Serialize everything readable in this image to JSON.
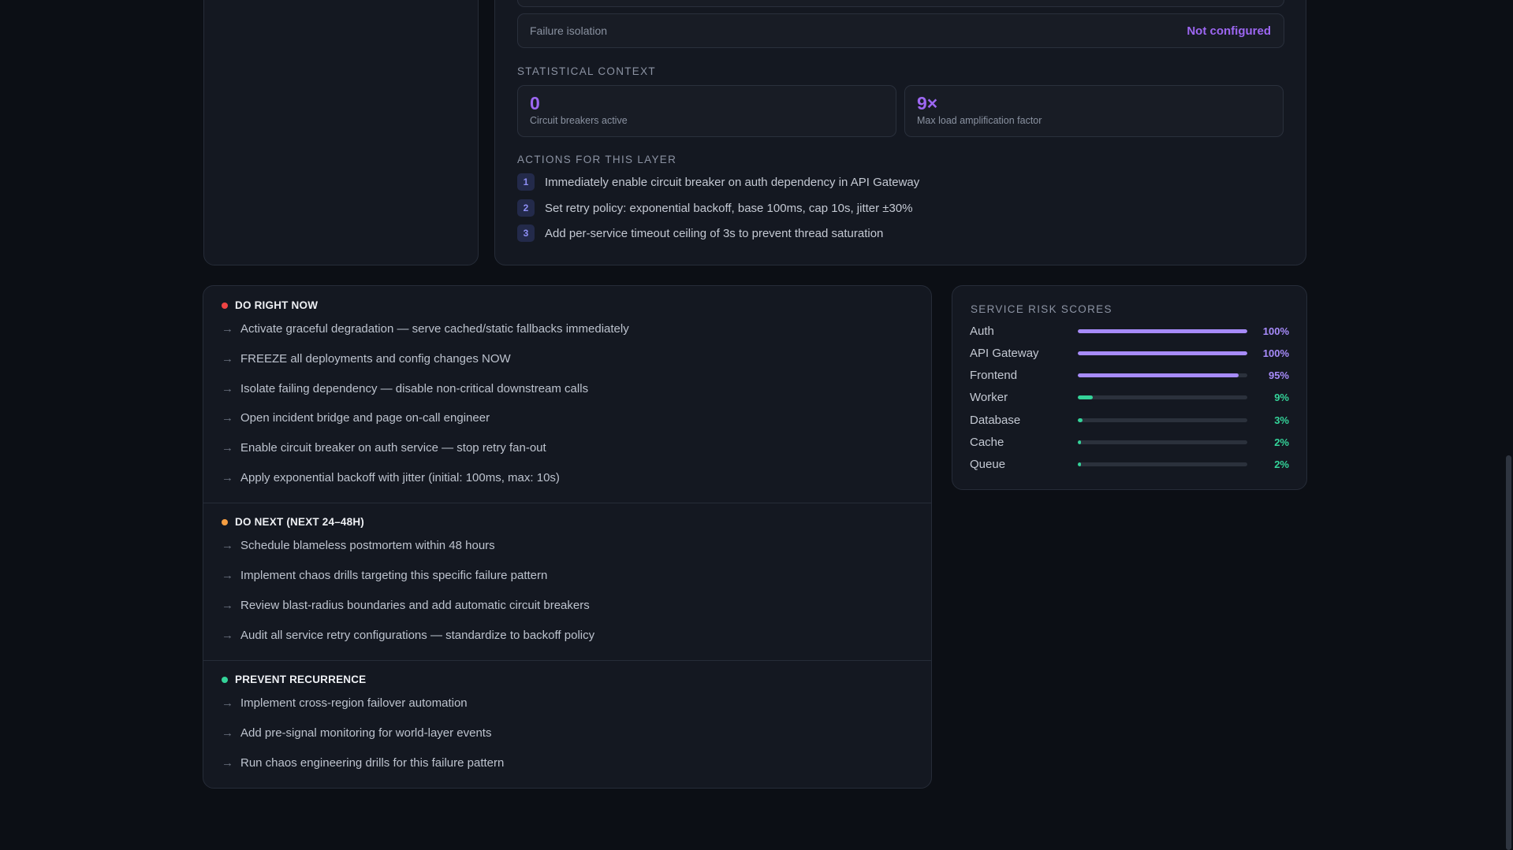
{
  "layer_panel": {
    "failure_isolation_label": "Failure isolation",
    "failure_isolation_value": "Not configured",
    "statistical_context_title": "STATISTICAL CONTEXT",
    "stats": [
      {
        "value": "0",
        "label": "Circuit breakers active"
      },
      {
        "value": "9×",
        "label": "Max load amplification factor"
      }
    ],
    "actions_title": "ACTIONS FOR THIS LAYER",
    "actions": [
      {
        "num": "1",
        "text": "Immediately enable circuit breaker on auth dependency in API Gateway"
      },
      {
        "num": "2",
        "text": "Set retry policy: exponential backoff, base 100ms, cap 10s, jitter ±30%"
      },
      {
        "num": "3",
        "text": "Add per-service timeout ceiling of 3s to prevent thread saturation"
      }
    ]
  },
  "recommendations": {
    "do_now": {
      "title": "DO RIGHT NOW",
      "color": "#ef4444",
      "items": [
        "Activate graceful degradation — serve cached/static fallbacks immediately",
        "FREEZE all deployments and config changes NOW",
        "Isolate failing dependency — disable non-critical downstream calls",
        "Open incident bridge and page on-call engineer",
        "Enable circuit breaker on auth service — stop retry fan-out",
        "Apply exponential backoff with jitter (initial: 100ms, max: 10s)"
      ]
    },
    "do_next": {
      "title": "DO NEXT (NEXT 24–48H)",
      "color": "#f59e42",
      "items": [
        "Schedule blameless postmortem within 48 hours",
        "Implement chaos drills targeting this specific failure pattern",
        "Review blast-radius boundaries and add automatic circuit breakers",
        "Audit all service retry configurations — standardize to backoff policy"
      ]
    },
    "prevent": {
      "title": "PREVENT RECURRENCE",
      "color": "#34d399",
      "items": [
        "Implement cross-region failover automation",
        "Add pre-signal monitoring for world-layer events",
        "Run chaos engineering drills for this failure pattern"
      ]
    },
    "arrow": "→"
  },
  "risk_scores": {
    "title": "SERVICE RISK SCORES",
    "high_color": "#a78bfa",
    "low_color": "#34d399",
    "services": [
      {
        "name": "Auth",
        "percent": 100,
        "label": "100%",
        "level": "high"
      },
      {
        "name": "API Gateway",
        "percent": 100,
        "label": "100%",
        "level": "high"
      },
      {
        "name": "Frontend",
        "percent": 95,
        "label": "95%",
        "level": "high"
      },
      {
        "name": "Worker",
        "percent": 9,
        "label": "9%",
        "level": "low"
      },
      {
        "name": "Database",
        "percent": 3,
        "label": "3%",
        "level": "low"
      },
      {
        "name": "Cache",
        "percent": 2,
        "label": "2%",
        "level": "low"
      },
      {
        "name": "Queue",
        "percent": 2,
        "label": "2%",
        "level": "low"
      }
    ]
  }
}
